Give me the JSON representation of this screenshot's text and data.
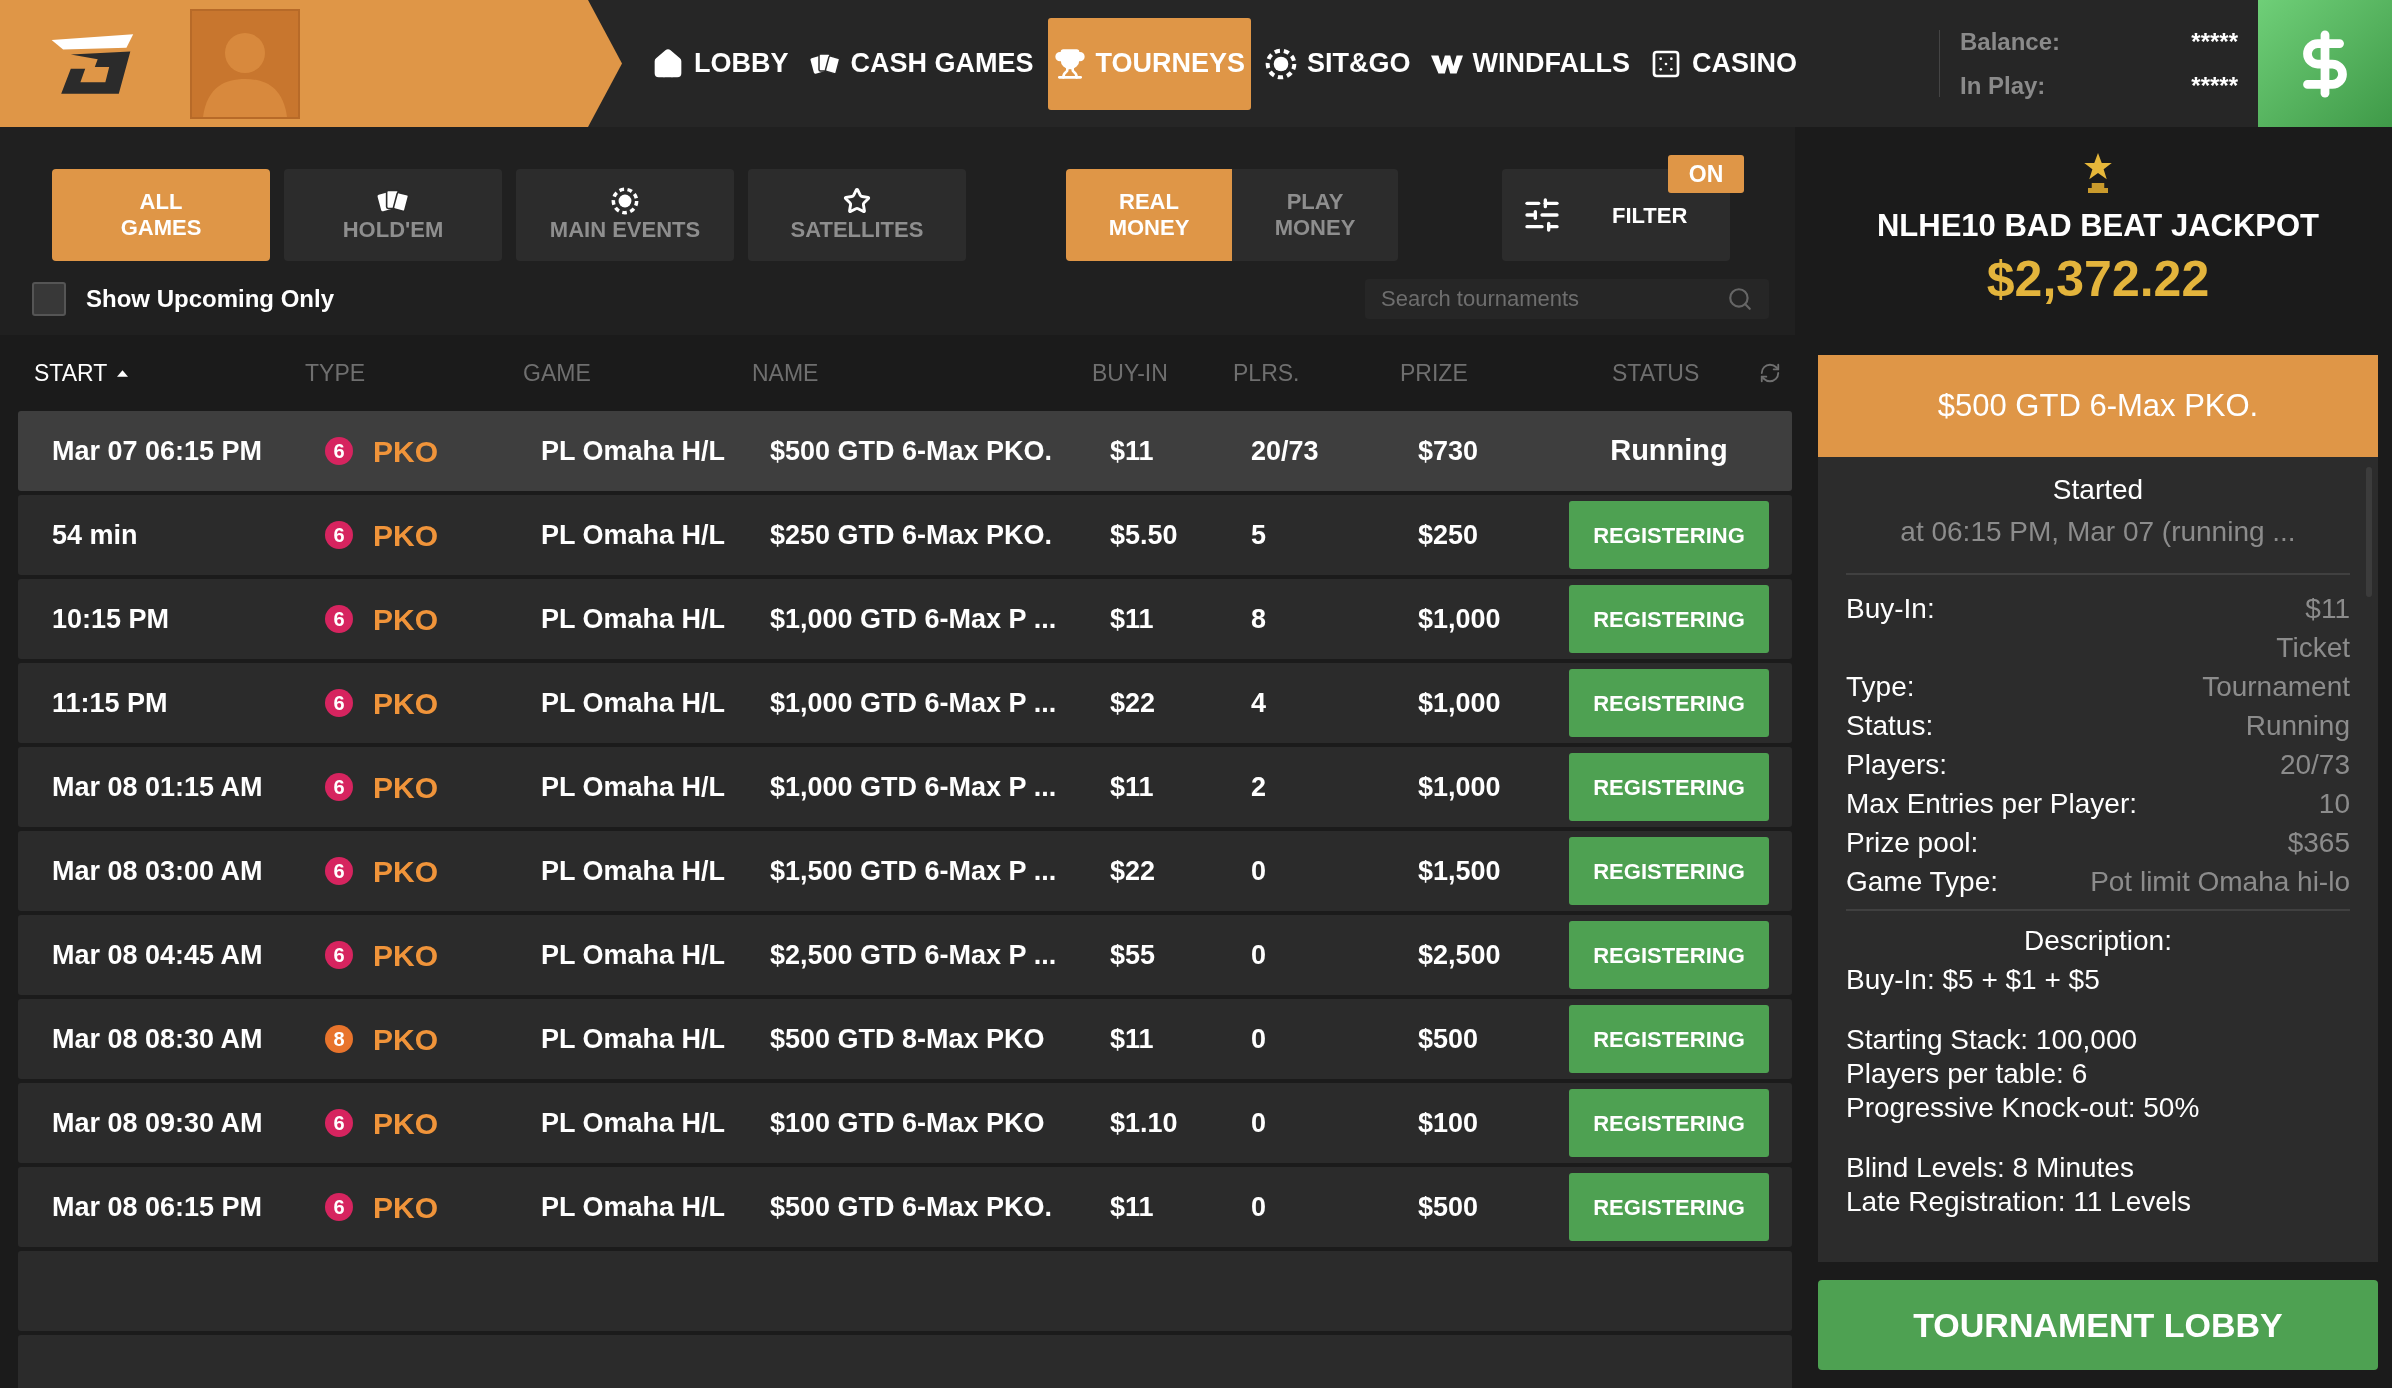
{
  "nav": [
    {
      "label": "LOBBY",
      "selected": false
    },
    {
      "label": "CASH GAMES",
      "selected": false
    },
    {
      "label": "TOURNEYS",
      "selected": true
    },
    {
      "label": "SIT&GO",
      "selected": false
    },
    {
      "label": "WINDFALLS",
      "selected": false
    },
    {
      "label": "CASINO",
      "selected": false
    }
  ],
  "account": {
    "balance_label": "Balance:",
    "balance": "*****",
    "in_play_label": "In Play:",
    "in_play": "*****"
  },
  "categories": [
    {
      "label": "ALL GAMES",
      "selected": true
    },
    {
      "label": "HOLD'EM",
      "selected": false
    },
    {
      "label": "MAIN EVENTS",
      "selected": false
    },
    {
      "label": "SATELLITES",
      "selected": false
    }
  ],
  "money": [
    {
      "label": "REAL MONEY",
      "selected": true
    },
    {
      "label": "PLAY MONEY",
      "selected": false
    }
  ],
  "filter": {
    "label": "FILTER",
    "badge": "ON"
  },
  "upcoming": {
    "label": "Show Upcoming Only",
    "checked": false
  },
  "search": {
    "placeholder": "Search tournaments"
  },
  "table": {
    "columns": [
      "START",
      "TYPE",
      "GAME",
      "NAME",
      "BUY-IN",
      "PLRS.",
      "PRIZE",
      "STATUS"
    ],
    "rows": [
      {
        "start": "Mar 07 06:15 PM",
        "seats": "6",
        "color": "#d6245f",
        "type": "PKO",
        "game": "PL Omaha H/L",
        "name": "$500 GTD 6-Max PKO.",
        "buy_in": "$11",
        "players": "20/73",
        "prize": "$730",
        "status": "Running",
        "kind": "text",
        "selected": true
      },
      {
        "start": "54 min",
        "seats": "6",
        "color": "#d6245f",
        "type": "PKO",
        "game": "PL Omaha H/L",
        "name": "$250 GTD 6-Max PKO.",
        "buy_in": "$5.50",
        "players": "5",
        "prize": "$250",
        "status": "REGISTERING",
        "kind": "button",
        "selected": false
      },
      {
        "start": "10:15 PM",
        "seats": "6",
        "color": "#d6245f",
        "type": "PKO",
        "game": "PL Omaha H/L",
        "name": "$1,000 GTD 6-Max P ...",
        "buy_in": "$11",
        "players": "8",
        "prize": "$1,000",
        "status": "REGISTERING",
        "kind": "button",
        "selected": false
      },
      {
        "start": "11:15 PM",
        "seats": "6",
        "color": "#d6245f",
        "type": "PKO",
        "game": "PL Omaha H/L",
        "name": "$1,000 GTD 6-Max P ...",
        "buy_in": "$22",
        "players": "4",
        "prize": "$1,000",
        "status": "REGISTERING",
        "kind": "button",
        "selected": false
      },
      {
        "start": "Mar 08 01:15 AM",
        "seats": "6",
        "color": "#d6245f",
        "type": "PKO",
        "game": "PL Omaha H/L",
        "name": "$1,000 GTD 6-Max P ...",
        "buy_in": "$11",
        "players": "2",
        "prize": "$1,000",
        "status": "REGISTERING",
        "kind": "button",
        "selected": false
      },
      {
        "start": "Mar 08 03:00 AM",
        "seats": "6",
        "color": "#d6245f",
        "type": "PKO",
        "game": "PL Omaha H/L",
        "name": "$1,500 GTD 6-Max P ...",
        "buy_in": "$22",
        "players": "0",
        "prize": "$1,500",
        "status": "REGISTERING",
        "kind": "button",
        "selected": false
      },
      {
        "start": "Mar 08 04:45 AM",
        "seats": "6",
        "color": "#d6245f",
        "type": "PKO",
        "game": "PL Omaha H/L",
        "name": "$2,500 GTD 6-Max P ...",
        "buy_in": "$55",
        "players": "0",
        "prize": "$2,500",
        "status": "REGISTERING",
        "kind": "button",
        "selected": false
      },
      {
        "start": "Mar 08 08:30 AM",
        "seats": "8",
        "color": "#e8742c",
        "type": "PKO",
        "game": "PL Omaha H/L",
        "name": "$500 GTD 8-Max PKO",
        "buy_in": "$11",
        "players": "0",
        "prize": "$500",
        "status": "REGISTERING",
        "kind": "button",
        "selected": false
      },
      {
        "start": "Mar 08 09:30 AM",
        "seats": "6",
        "color": "#d6245f",
        "type": "PKO",
        "game": "PL Omaha H/L",
        "name": "$100 GTD 6-Max PKO",
        "buy_in": "$1.10",
        "players": "0",
        "prize": "$100",
        "status": "REGISTERING",
        "kind": "button",
        "selected": false
      },
      {
        "start": "Mar 08 06:15 PM",
        "seats": "6",
        "color": "#d6245f",
        "type": "PKO",
        "game": "PL Omaha H/L",
        "name": "$500 GTD 6-Max PKO.",
        "buy_in": "$11",
        "players": "0",
        "prize": "$500",
        "status": "REGISTERING",
        "kind": "button",
        "selected": false
      }
    ]
  },
  "jackpot": {
    "title": "NLHE10 BAD BEAT JACKPOT",
    "amount": "$2,372.22"
  },
  "details": {
    "title": "$500 GTD 6-Max PKO.",
    "state": "Started",
    "when": "at 06:15 PM, Mar 07 (running ...",
    "fields": [
      {
        "label": "Buy-In:",
        "values": [
          "$11",
          "Ticket"
        ]
      },
      {
        "label": "Type:",
        "values": [
          "Tournament"
        ]
      },
      {
        "label": "Status:",
        "values": [
          "Running"
        ]
      },
      {
        "label": "Players:",
        "values": [
          "20/73"
        ]
      },
      {
        "label": "Max Entries per Player:",
        "values": [
          "10"
        ]
      },
      {
        "label": "Prize pool:",
        "values": [
          "$365"
        ]
      },
      {
        "label": "Game Type:",
        "values": [
          "Pot limit Omaha hi-lo"
        ]
      }
    ],
    "description_title": "Description:",
    "description": [
      [
        "Buy-In: $5 + $1 + $5"
      ],
      [
        "Starting Stack: 100,000",
        "Players per table: 6",
        "Progressive Knock-out: 50%"
      ],
      [
        "Blind Levels: 8 Minutes",
        "Late Registration: 11 Levels"
      ]
    ],
    "button": "TOURNAMENT LOBBY"
  }
}
